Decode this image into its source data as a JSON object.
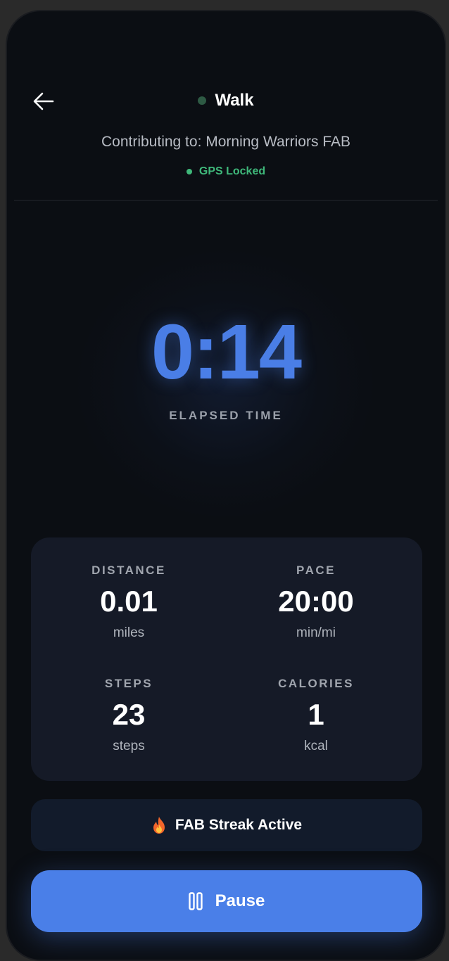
{
  "header": {
    "back_icon": "arrow-left-icon",
    "activity_title": "Walk",
    "activity_dot_color": "#2e5a44",
    "contributing_text": "Contributing to: Morning Warriors FAB",
    "gps_status": "GPS Locked",
    "gps_color": "#3fb87a"
  },
  "timer": {
    "value": "0:14",
    "label": "ELAPSED TIME",
    "color": "#4a7ee6"
  },
  "stats": {
    "distance": {
      "label": "DISTANCE",
      "value": "0.01",
      "unit": "miles"
    },
    "pace": {
      "label": "PACE",
      "value": "20:00",
      "unit": "min/mi"
    },
    "steps": {
      "label": "STEPS",
      "value": "23",
      "unit": "steps"
    },
    "calories": {
      "label": "CALORIES",
      "value": "1",
      "unit": "kcal"
    }
  },
  "streak": {
    "icon": "flame-icon",
    "text": "FAB Streak Active"
  },
  "controls": {
    "pause_icon": "pause-icon",
    "pause_label": "Pause",
    "accent_color": "#4a7fe8"
  }
}
